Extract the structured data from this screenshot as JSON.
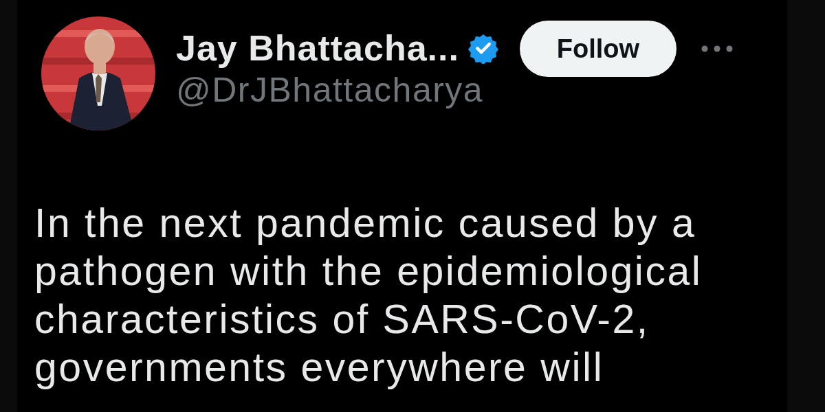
{
  "post": {
    "author": {
      "name": "Jay Bhattacha...",
      "verified": true,
      "handle": "@DrJBhattacharya"
    },
    "follow_button": "Follow",
    "text_lines": [
      "In the next pandemic caused by a",
      "pathogen with the epidemiological",
      "characteristics of SARS-CoV-2,",
      "governments everywhere will"
    ]
  }
}
